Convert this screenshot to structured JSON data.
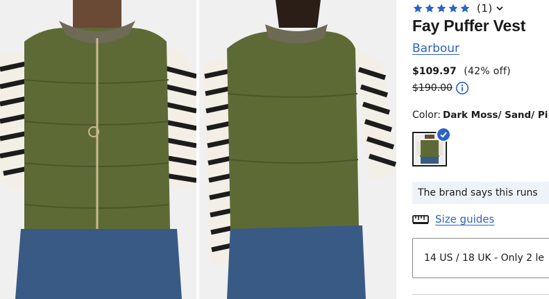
{
  "product": {
    "rating_count": "(1)",
    "stars": 5,
    "title": "Fay Puffer Vest",
    "brand": "Barbour",
    "price": "$109.97",
    "discount": "(42% off)",
    "original_price": "$190.00",
    "color_label": "Color:",
    "color_value": "Dark Moss/ Sand/ Pi",
    "fit_note": "The brand says this runs",
    "size_guide_label": "Size guides",
    "size_selected": "14 US / 18 UK - Only 2 le"
  },
  "icons": {
    "rating": "star-icon",
    "dropdown": "chevron-down-icon",
    "info": "info-icon",
    "selected": "check-icon",
    "size_guide": "ruler-icon"
  },
  "colors": {
    "accent": "#2b63c6",
    "star": "#2b63c6",
    "vest": "#5d6a36",
    "note_bg": "#eef3f9"
  }
}
